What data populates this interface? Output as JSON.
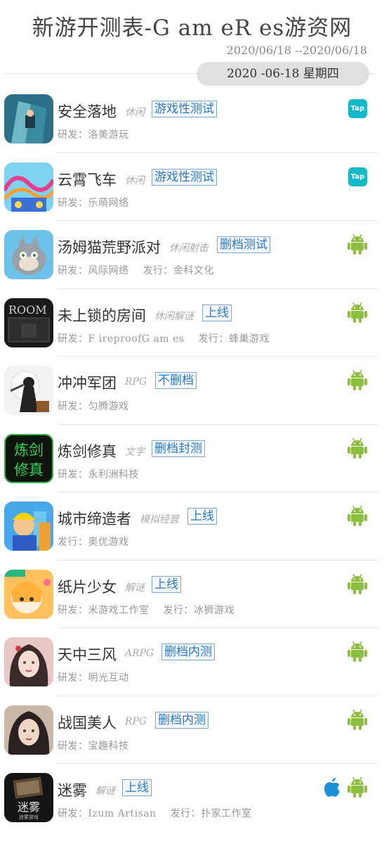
{
  "header": {
    "title": "新游开测表-G am eR es游资网",
    "date_range": "2020/06/18 --2020/06/18",
    "date_label": "2020 -06-18 星期四"
  },
  "games": [
    {
      "name": "安全落地",
      "genre": "休闲",
      "status": "游戏性测试",
      "dev": "研发：洛美游玩",
      "pub": "",
      "platforms": [
        "tap"
      ],
      "icon": "safe-landing-icon"
    },
    {
      "name": "云霄飞车",
      "genre": "休闲",
      "status": "游戏性测试",
      "dev": "研发：乐萌网络",
      "pub": "",
      "platforms": [
        "tap"
      ],
      "icon": "roller-coaster-icon"
    },
    {
      "name": "汤姆猫荒野派对",
      "genre": "休闲射击",
      "status": "删档测试",
      "dev": "研发：风际网络",
      "pub": "发行：金科文化",
      "platforms": [
        "android"
      ],
      "icon": "tom-cat-icon"
    },
    {
      "name": "未上锁的房间",
      "genre": "休闲解谜",
      "status": "上线",
      "dev": "研发：F ireproofG am es",
      "pub": "发行：蜂巢游戏",
      "platforms": [
        "android"
      ],
      "icon": "room-icon"
    },
    {
      "name": "冲冲军团",
      "genre": "RPG",
      "status": "不删档",
      "dev": "研发：匀腾游戏",
      "pub": "",
      "platforms": [
        "android"
      ],
      "icon": "ninja-icon"
    },
    {
      "name": "炼剑修真",
      "genre": "文字",
      "status": "删档封测",
      "dev": "研发：永利洲科技",
      "pub": "",
      "platforms": [
        "android"
      ],
      "icon": "sword-cultivation-icon",
      "icon_text": [
        "炼剑",
        "修真"
      ]
    },
    {
      "name": "城市缔造者",
      "genre": "模拟经营",
      "status": "上线",
      "dev": "",
      "pub": "发行：奥优游戏",
      "platforms": [
        "android"
      ],
      "icon": "city-builder-icon"
    },
    {
      "name": "纸片少女",
      "genre": "解谜",
      "status": "上线",
      "dev": "研发：米游戏工作室",
      "pub": "发行：冰狮游戏",
      "platforms": [
        "android"
      ],
      "icon": "paper-girl-icon"
    },
    {
      "name": "天中三风",
      "genre": "ARPG",
      "status": "删档内测",
      "dev": "研发：明光互动",
      "pub": "",
      "platforms": [
        "android"
      ],
      "icon": "heroine-portrait-icon"
    },
    {
      "name": "战国美人",
      "genre": "RPG",
      "status": "删档内测",
      "dev": "研发：宝趣科技",
      "pub": "",
      "platforms": [
        "android"
      ],
      "icon": "beauty-portrait-icon"
    },
    {
      "name": "迷雾",
      "genre": "解谜",
      "status": "上线",
      "dev": "研发：Izum Artisan",
      "pub": "发行：扑家工作室",
      "platforms": [
        "apple",
        "android"
      ],
      "icon": "mist-icon",
      "icon_text": [
        "迷雾",
        "迷雾游戏"
      ]
    }
  ],
  "platform_labels": {
    "tap": "Tap"
  },
  "colors": {
    "status_text": "#2a78c2",
    "android": "#8cbf3f",
    "apple": "#1b8ed8",
    "tap": "#14b9c8"
  }
}
